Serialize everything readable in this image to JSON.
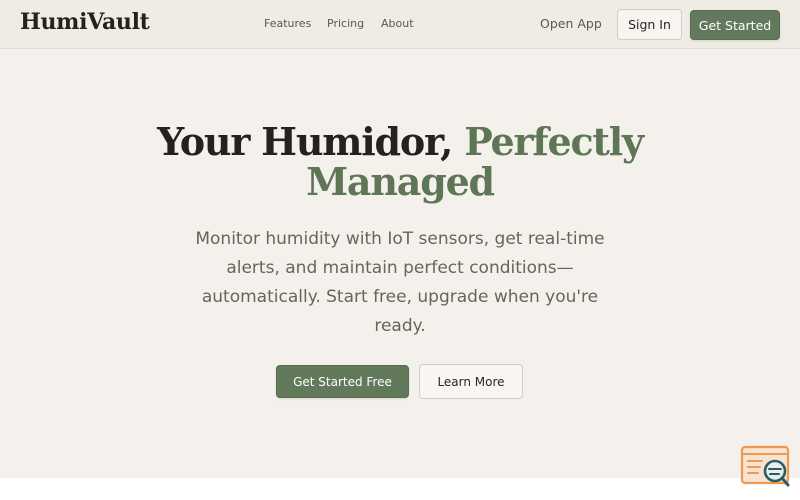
{
  "header": {
    "logo": "HumiVault",
    "nav": [
      {
        "label": "Features"
      },
      {
        "label": "Pricing"
      },
      {
        "label": "About"
      }
    ],
    "open_app": "Open App",
    "sign_in": "Sign In",
    "get_started": "Get Started"
  },
  "hero": {
    "title_main": "Your Humidor,",
    "title_accent_1": "Perfectly",
    "title_accent_2": "Managed",
    "subtitle": "Monitor humidity with IoT sensors, get real-time alerts, and maintain perfect conditions—automatically. Start free, upgrade when you're ready.",
    "cta_primary": "Get Started Free",
    "cta_secondary": "Learn More"
  },
  "widget": {
    "icon": "search-chat-icon"
  },
  "colors": {
    "accent": "#627a5b",
    "background": "#f4f1ec",
    "text": "#25211d",
    "widget_orange": "#ec9a55",
    "widget_teal": "#2f5c63"
  }
}
